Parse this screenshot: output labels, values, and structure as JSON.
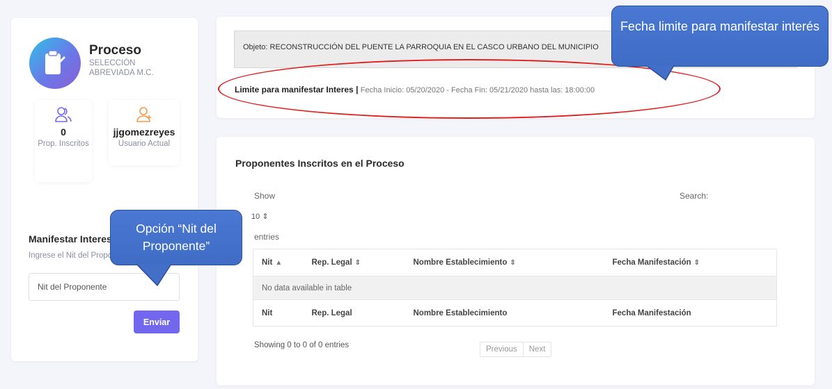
{
  "left": {
    "process_title": "Proceso",
    "process_subtitle": "SELECCIÓN ABREVIADA M.C.",
    "stats": [
      {
        "value": "0",
        "label": "Prop. Inscritos",
        "icon": "users-icon"
      },
      {
        "value": "jjgomezreyes",
        "label": "Usuario Actual",
        "icon": "user-plus-icon"
      }
    ],
    "manifest_title": "Manifestar Interes",
    "manifest_hint": "Ingrese el Nit del Proponente",
    "nit_placeholder": "Nit del Proponente",
    "submit_label": "Enviar"
  },
  "top": {
    "objeto": "Objeto: RECONSTRUCCIÓN DEL PUENTE LA PARROQUIA EN EL CASCO URBANO DEL MUNICIPIO",
    "limite_label": "Limite para manifestar Interes",
    "limite_separator": "|",
    "limite_detail": "Fecha Inicio: 05/20/2020 - Fecha Fin: 05/21/2020 hasta las: 18:00:00"
  },
  "table_section": {
    "title": "Proponentes Inscritos en el Proceso",
    "show_label": "Show",
    "page_length": "10",
    "entries_label": "entries",
    "search_label": "Search:",
    "columns": [
      "Nit",
      "Rep. Legal",
      "Nombre Establecimiento",
      "Fecha Manifestación"
    ],
    "empty_message": "No data available in table",
    "info": "Showing 0 to 0 of 0 entries",
    "previous_label": "Previous",
    "next_label": "Next"
  },
  "callouts": {
    "fecha": "Fecha limite para manifestar interés",
    "nit": "Opción “Nit del Proponente”"
  },
  "colors": {
    "accent": "#7367f0",
    "callout_blue": "#4a78d2",
    "ellipse_red": "#e01f1f"
  }
}
